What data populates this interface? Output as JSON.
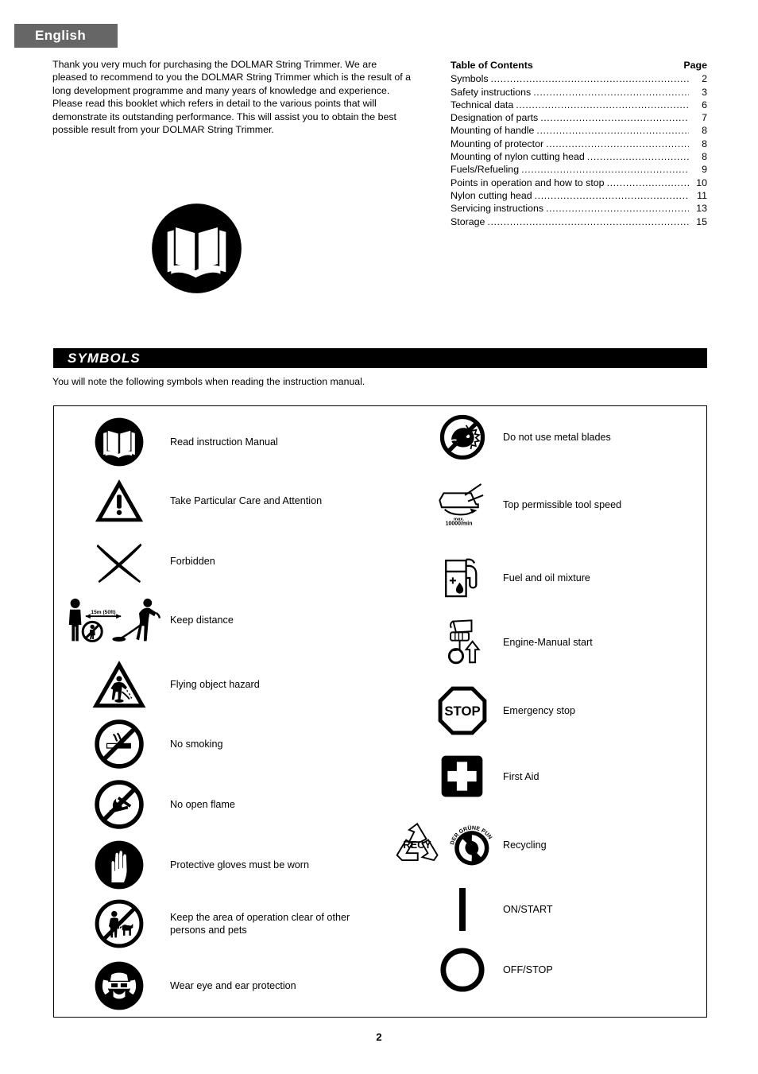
{
  "language_badge": {
    "label": "English"
  },
  "intro": {
    "paragraph1": "Thank you very much for purchasing the DOLMAR String Trimmer.  We are pleased to recommend to you the DOLMAR String Trimmer which is the result of a long development programme and many years of knowledge and experience.",
    "paragraph2": "Please read this booklet which refers in detail to the various points that will demonstrate its outstanding performance.  This will assist you to obtain the best possible result from your DOLMAR String Trimmer."
  },
  "toc": {
    "title": "Table of Contents",
    "page_header": "Page",
    "entries": [
      {
        "title": "Symbols",
        "page": "2"
      },
      {
        "title": "Safety instructions",
        "page": "3"
      },
      {
        "title": "Technical data",
        "page": "6"
      },
      {
        "title": "Designation of parts",
        "page": "7"
      },
      {
        "title": "Mounting of handle",
        "page": "8"
      },
      {
        "title": "Mounting of protector",
        "page": "8"
      },
      {
        "title": "Mounting of nylon cutting head",
        "page": "8"
      },
      {
        "title": "Fuels/Refueling",
        "page": "9"
      },
      {
        "title": "Points in operation and how to stop",
        "page": "10"
      },
      {
        "title": "Nylon cutting head",
        "page": "11"
      },
      {
        "title": "Servicing instructions",
        "page": "13"
      },
      {
        "title": "Storage",
        "page": "15"
      }
    ]
  },
  "section": {
    "heading": "SYMBOLS",
    "subtitle": "You will note the following symbols when reading the instruction manual."
  },
  "symbols": {
    "left": [
      {
        "icon": "read-instruction-manual-icon",
        "label": "Read instruction Manual"
      },
      {
        "icon": "warning-triangle-icon",
        "label": "Take Particular Care and Attention"
      },
      {
        "icon": "forbidden-cross-icon",
        "label": "Forbidden"
      },
      {
        "icon": "keep-distance-icon",
        "label": "Keep distance",
        "inline_text": "15m (50ft)"
      },
      {
        "icon": "flying-object-hazard-icon",
        "label": "Flying object hazard"
      },
      {
        "icon": "no-smoking-icon",
        "label": "No smoking"
      },
      {
        "icon": "no-open-flame-icon",
        "label": "No open flame"
      },
      {
        "icon": "protective-gloves-icon",
        "label": "Protective gloves must be worn"
      },
      {
        "icon": "no-persons-or-pets-icon",
        "label": "Keep the area of operation clear of other persons and pets"
      },
      {
        "icon": "eye-ear-protection-icon",
        "label": "Wear eye and ear protection"
      }
    ],
    "right": [
      {
        "icon": "no-metal-blades-icon",
        "label": "Do not use metal blades"
      },
      {
        "icon": "top-tool-speed-icon",
        "label": "Top permissible tool speed",
        "inline_text_1": "max.",
        "inline_text_2": "10000/min"
      },
      {
        "icon": "fuel-oil-mixture-icon",
        "label": "Fuel and oil mixture"
      },
      {
        "icon": "engine-manual-start-icon",
        "label": "Engine-Manual start"
      },
      {
        "icon": "emergency-stop-icon",
        "label": "Emergency stop",
        "inline_text": "STOP"
      },
      {
        "icon": "first-aid-icon",
        "label": "First Aid"
      },
      {
        "icon": "recycling-icon",
        "label": "Recycling",
        "inline_text_1": "RECY",
        "inline_text_2": "DER GRÜNE PUNKT"
      },
      {
        "icon": "on-start-icon",
        "label": "ON/START"
      },
      {
        "icon": "off-stop-icon",
        "label": "OFF/STOP"
      }
    ]
  },
  "footer": {
    "page_number": "2"
  }
}
